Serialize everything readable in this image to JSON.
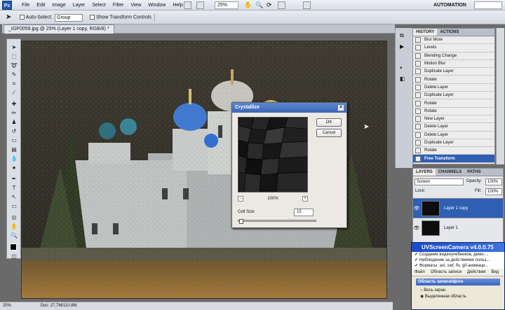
{
  "app": {
    "logo": "Ps",
    "menus": [
      "File",
      "Edit",
      "Image",
      "Layer",
      "Select",
      "Filter",
      "View",
      "Window",
      "Help"
    ],
    "zoom": "25%",
    "workspace": "AUTOMATION"
  },
  "options_bar": {
    "auto_select_label": "Auto-Select:",
    "auto_select_value": "Group",
    "show_transform_label": "Show Transform Controls"
  },
  "document": {
    "tab_title": "_IGP0059.jpg @ 25% (Layer 1 copy, RGB/8) *",
    "status_zoom": "25%",
    "status_doc": "Doc: 27,7M/110,8M"
  },
  "history_panel": {
    "tabs": [
      "HISTORY",
      "ACTIONS"
    ],
    "items": [
      "Blur More",
      "Levels",
      "Blending Change",
      "Motion Blur",
      "Duplicate Layer",
      "Rotate",
      "Delete Layer",
      "Duplicate Layer",
      "Rotate",
      "Rotate",
      "New Layer",
      "Delete Layer",
      "Delete Layer",
      "Duplicate Layer",
      "Rotate",
      "Free Transform"
    ],
    "selected_index": 15
  },
  "layers_panel": {
    "tabs": [
      "LAYERS",
      "CHANNELS",
      "PATHS"
    ],
    "blend_mode": "Screen",
    "opacity_label": "Opacity:",
    "opacity_value": "100%",
    "lock_label": "Lock:",
    "fill_label": "Fill:",
    "fill_value": "100%",
    "layers": [
      "Layer 1 copy",
      "Layer 1"
    ]
  },
  "crystallize_dialog": {
    "title": "Crystallize",
    "ok_label": "OK",
    "cancel_label": "Cancel",
    "zoom_minus": "−",
    "zoom_value": "100%",
    "zoom_plus": "+",
    "cell_size_label": "Cell Size",
    "cell_size_value": "15",
    "cell_size_fraction": 0.02
  },
  "uvscreencamera": {
    "title": "UVScreenCamera v4.0.0.75",
    "features": [
      "Создание видеоучебников, демо-...",
      "Наблюдение за действиями польз...",
      "Форматы: avi, swf, flv, gif-анимаци..."
    ],
    "menu": [
      "Файл",
      "Область записи",
      "Действия",
      "Вид"
    ],
    "section_title": "Область записи/фото",
    "opt_full": "Весь экран",
    "opt_selected": "Выделенная область"
  },
  "colors": {
    "selection_blue": "#2f5fb3",
    "dialog_title": "#3e67b6"
  }
}
